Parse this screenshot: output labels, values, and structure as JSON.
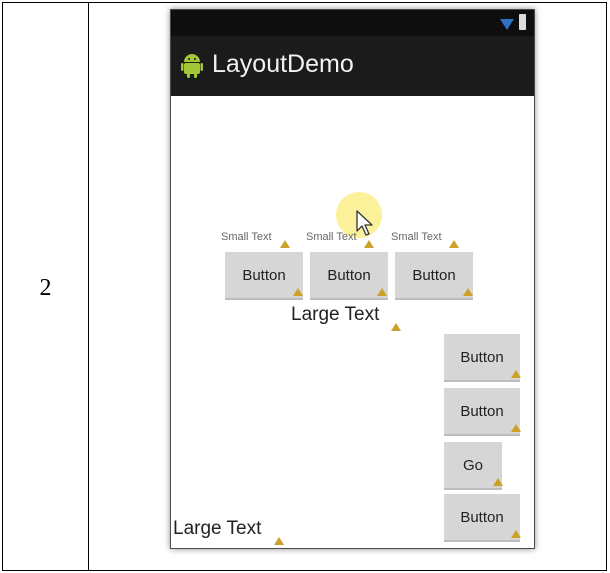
{
  "row_number": "2",
  "app": {
    "title": "LayoutDemo",
    "icon": "android-icon"
  },
  "status_bar": {
    "icons": [
      "wifi-icon",
      "battery-icon"
    ]
  },
  "top_group": {
    "small_texts": [
      "Small Text",
      "Small Text",
      "Small Text"
    ],
    "buttons": [
      "Button",
      "Button",
      "Button"
    ]
  },
  "large_text_center": "Large Text",
  "right_buttons": [
    "Button",
    "Button",
    "Go",
    "Button"
  ],
  "large_text_bottom": "Large Text",
  "colors": {
    "action_bar": "#1b1b1b",
    "status_bar": "#0e0e0e",
    "button": "#d6d6d6",
    "warning": "#c9a227",
    "wifi": "#2f6fc4"
  }
}
